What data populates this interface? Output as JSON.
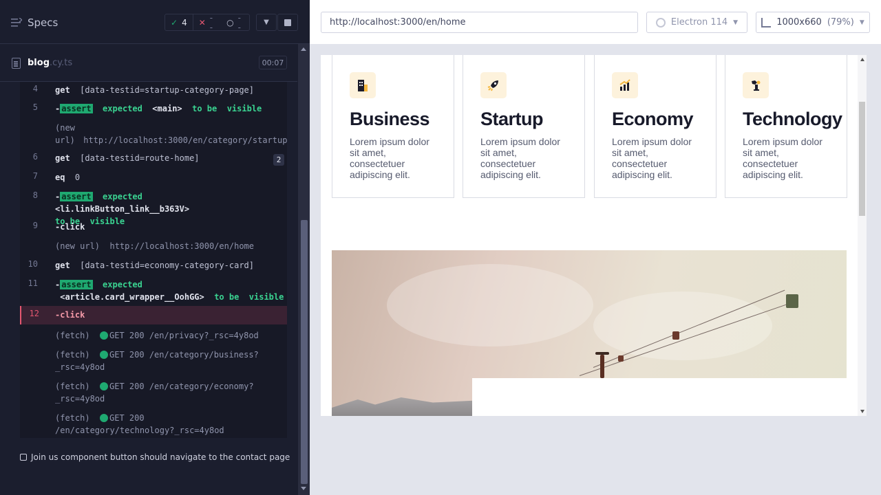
{
  "reporter": {
    "title": "Specs",
    "stats": {
      "passed": "4",
      "failed": "--",
      "pending": "--"
    },
    "spec": {
      "name": "blog",
      "ext": ".cy.ts",
      "duration": "00:07"
    },
    "commands": [
      {
        "num": "4",
        "kw": "get",
        "text": "[data-testid=startup-category-page]"
      },
      {
        "num": "5",
        "prefix": "-",
        "badge": "assert",
        "pre": "expected",
        "tag": "<main>",
        "mid": "to be",
        "post": "visible"
      },
      {
        "num": "",
        "muted": "(new url)",
        "url": "http://localhost:3000/en/category/startup"
      },
      {
        "num": "6",
        "kw": "get",
        "text": "[data-testid=route-home]",
        "count": "2"
      },
      {
        "num": "7",
        "kw": "eq",
        "text": "0"
      },
      {
        "num": "8",
        "prefix": "-",
        "badge": "assert",
        "pre": "expected",
        "tag": "<li.linkButton_link__b363V>",
        "mid": "to be",
        "post": "visible"
      },
      {
        "num": "9",
        "kw": "-click"
      },
      {
        "num": "",
        "muted": "(new url)",
        "url": "http://localhost:3000/en/home"
      },
      {
        "num": "10",
        "kw": "get",
        "text": "[data-testid=economy-category-card]"
      },
      {
        "num": "11",
        "prefix": "-",
        "badge": "assert",
        "pre": "expected",
        "tag": "<article.card_wrapper__OohGG>",
        "mid": "to be",
        "post": "visible"
      },
      {
        "num": "12",
        "kw": "-click"
      },
      {
        "num": "",
        "muted": "(fetch)",
        "req": "GET 200 /en/privacy?_rsc=4y8od"
      },
      {
        "num": "",
        "muted": "(fetch)",
        "req": "GET 200 /en/category/business?_rsc=4y8od"
      },
      {
        "num": "",
        "muted": "(fetch)",
        "req": "GET 200 /en/category/economy?_rsc=4y8od"
      },
      {
        "num": "",
        "muted": "(fetch)",
        "req": "GET 200 /en/category/technology?_rsc=4y8od"
      }
    ],
    "next_test": "Join us component button should navigate to the contact page"
  },
  "aut": {
    "url": "http://localhost:3000/en/home",
    "browser": "Electron 114",
    "viewport": "1000x660",
    "zoom": "(79%)",
    "cards": [
      {
        "title": "Business",
        "text": "Lorem ipsum dolor sit amet, consectetuer adipiscing elit.",
        "icon": "building-icon"
      },
      {
        "title": "Startup",
        "text": "Lorem ipsum dolor sit amet, consectetuer adipiscing elit.",
        "icon": "rocket-icon"
      },
      {
        "title": "Economy",
        "text": "Lorem ipsum dolor sit amet, consectetuer adipiscing elit.",
        "icon": "chart-icon"
      },
      {
        "title": "Technology",
        "text": "Lorem ipsum dolor sit amet, consectetuer adipiscing elit.",
        "icon": "robot-arm-icon"
      }
    ]
  },
  "colors": {
    "reporter_bg": "#1b1e2e",
    "pass": "#1fa971",
    "fail": "#e45770",
    "accent_icon_bg": "#fdf2dc"
  }
}
